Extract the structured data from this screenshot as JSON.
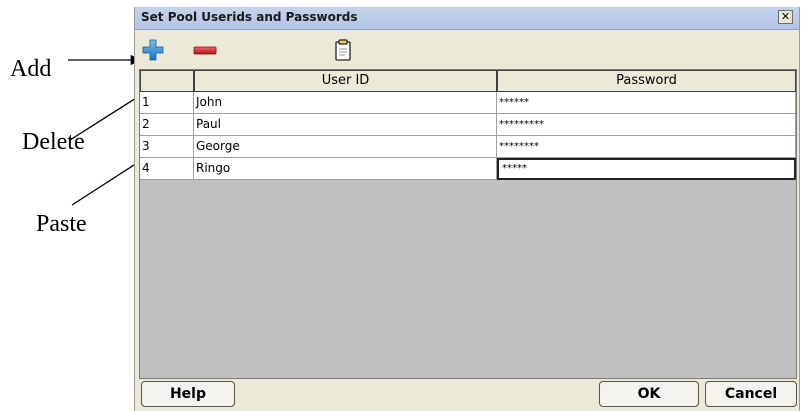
{
  "annotations": {
    "add": "Add",
    "delete": "Delete",
    "paste": "Paste"
  },
  "window": {
    "title": "Set Pool Userids and Passwords",
    "close_glyph": "✕"
  },
  "toolbar": {
    "add_icon": "plus-icon",
    "delete_icon": "minus-icon",
    "paste_icon": "clipboard-icon",
    "add_color": "#2f86d6",
    "delete_color": "#d0202a"
  },
  "table": {
    "columns": [
      "",
      "User ID",
      "Password"
    ],
    "rows": [
      {
        "num": "1",
        "user": "John",
        "password": "******"
      },
      {
        "num": "2",
        "user": "Paul",
        "password": "*********"
      },
      {
        "num": "3",
        "user": "George",
        "password": "********"
      },
      {
        "num": "4",
        "user": "Ringo",
        "password": "*****"
      }
    ]
  },
  "buttons": {
    "help": "Help",
    "ok": "OK",
    "cancel": "Cancel"
  }
}
